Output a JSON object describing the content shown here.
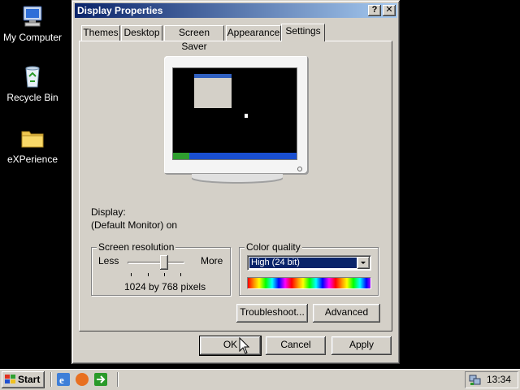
{
  "desktop": {
    "icons": [
      {
        "label": "My Computer",
        "icon": "computer-icon"
      },
      {
        "label": "Recycle Bin",
        "icon": "recycle-bin-icon"
      },
      {
        "label": "eXPerience",
        "icon": "folder-icon"
      }
    ]
  },
  "dialog": {
    "title": "Display Properties",
    "help_button": "?",
    "close_button": "✕",
    "tabs": [
      {
        "label": "Themes",
        "active": false
      },
      {
        "label": "Desktop",
        "active": false
      },
      {
        "label": "Screen Saver",
        "active": false
      },
      {
        "label": "Appearance",
        "active": false
      },
      {
        "label": "Settings",
        "active": true
      }
    ],
    "display_label": "Display:",
    "display_value": "(Default Monitor) on",
    "resolution": {
      "group_title": "Screen resolution",
      "less_label": "Less",
      "more_label": "More",
      "value_text": "1024 by 768 pixels",
      "slider_level": 0.6
    },
    "color_quality": {
      "group_title": "Color quality",
      "selected": "High (24 bit)"
    },
    "troubleshoot_button": "Troubleshoot...",
    "advanced_button": "Advanced",
    "ok_button": "OK",
    "cancel_button": "Cancel",
    "apply_button": "Apply"
  },
  "taskbar": {
    "start_label": "Start",
    "quick_launch": [
      "internet-explorer-icon",
      "firefox-icon",
      "arrow-icon"
    ],
    "clock": "13:34",
    "tray_icon": "network-icon"
  },
  "colors": {
    "titlebar_start": "#0a246a",
    "titlebar_end": "#a6caf0",
    "face": "#d4d0c8",
    "selection": "#0a246a"
  }
}
